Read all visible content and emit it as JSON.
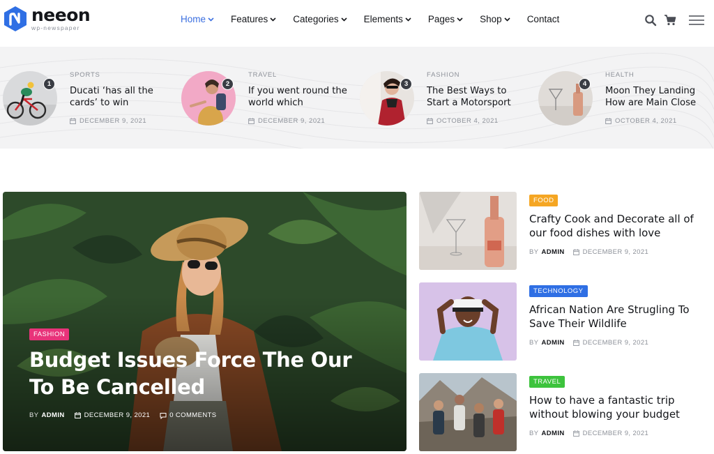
{
  "brand": {
    "name": "neeon",
    "tagline": "wp-newspaper",
    "accent": "#2f6fe4"
  },
  "nav": {
    "items": [
      {
        "label": "Home",
        "has_dropdown": true,
        "active": true
      },
      {
        "label": "Features",
        "has_dropdown": true
      },
      {
        "label": "Categories",
        "has_dropdown": true
      },
      {
        "label": "Elements",
        "has_dropdown": true
      },
      {
        "label": "Pages",
        "has_dropdown": true
      },
      {
        "label": "Shop",
        "has_dropdown": true
      },
      {
        "label": "Contact",
        "has_dropdown": false
      }
    ],
    "icons": [
      "search-icon",
      "cart-icon",
      "menu-icon"
    ]
  },
  "trending": [
    {
      "rank": "1",
      "category": "SPORTS",
      "title": "Ducati ‘has all the cards’ to win",
      "date": "DECEMBER 9, 2021"
    },
    {
      "rank": "2",
      "category": "TRAVEL",
      "title": "If you went round the world which",
      "date": "DECEMBER 9, 2021"
    },
    {
      "rank": "3",
      "category": "FASHION",
      "title": "The Best Ways to Start a Motorsport",
      "date": "OCTOBER 4, 2021"
    },
    {
      "rank": "4",
      "category": "HEALTH",
      "title": "Moon They Landing How are Main Close",
      "date": "OCTOBER 4, 2021"
    }
  ],
  "hero": {
    "category": "FASHION",
    "category_color": "#e8337a",
    "title": "Budget Issues Force The Our To Be Cancelled",
    "by": "BY",
    "author": "ADMIN",
    "date": "DECEMBER 9, 2021",
    "comments": "0 COMMENTS"
  },
  "side_posts": [
    {
      "category": "FOOD",
      "category_color": "#f5a623",
      "title": "Crafty Cook and Decorate all of our food dishes with love",
      "by": "BY",
      "author": "ADMIN",
      "date": "DECEMBER 9, 2021"
    },
    {
      "category": "TECHNOLOGY",
      "category_color": "#2f6fe4",
      "title": "African Nation Are Strugling To Save Their Wildlife",
      "by": "BY",
      "author": "ADMIN",
      "date": "DECEMBER 9, 2021"
    },
    {
      "category": "TRAVEL",
      "category_color": "#3dc33d",
      "title": "How to have a fantastic trip without blowing your budget",
      "by": "BY",
      "author": "ADMIN",
      "date": "DECEMBER 9, 2021"
    }
  ]
}
